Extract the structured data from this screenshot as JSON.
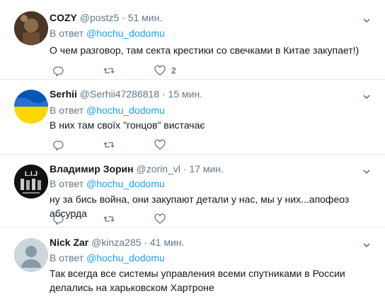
{
  "tweets": [
    {
      "name": "COZY",
      "handle": "@postz5",
      "dot": "·",
      "time": "51 мин.",
      "reply_label": "В ответ",
      "reply_mention": "@hochu_dodomu",
      "text": "О чем разговор, там секта крестики со свечками в Китае закупает!)",
      "like_count": "2"
    },
    {
      "name": "Serhii",
      "handle": "@Serhii47286818",
      "dot": "·",
      "time": "15 мин.",
      "reply_label": "В ответ",
      "reply_mention": "@hochu_dodomu",
      "text": "В них там своїх \"гонцов\" вистачає",
      "like_count": ""
    },
    {
      "name": "Владимир Зорин",
      "handle": "@zorin_vl",
      "dot": "·",
      "time": "17 мин.",
      "reply_label": "В ответ",
      "reply_mention": "@hochu_dodomu",
      "text": "ну за  бись война, они закупают детали у нас, мы у них...апофеоз абсурда",
      "like_count": "",
      "avatar_text": "L.I.J"
    },
    {
      "name": "Nick Zar",
      "handle": "@kinza285",
      "dot": "·",
      "time": "41 мин.",
      "reply_label": "В ответ",
      "reply_mention": "@hochu_dodomu",
      "text": "Так всегда все системы управления всеми спутниками в России делались на харьковском Хартроне",
      "like_count": ""
    }
  ],
  "colors": {
    "accent": "#1da1f2",
    "secondary_text": "#657786",
    "divider": "#e6ecf0"
  },
  "icons": [
    "reply-icon",
    "retweet-icon",
    "like-icon",
    "chevron-down-icon"
  ]
}
